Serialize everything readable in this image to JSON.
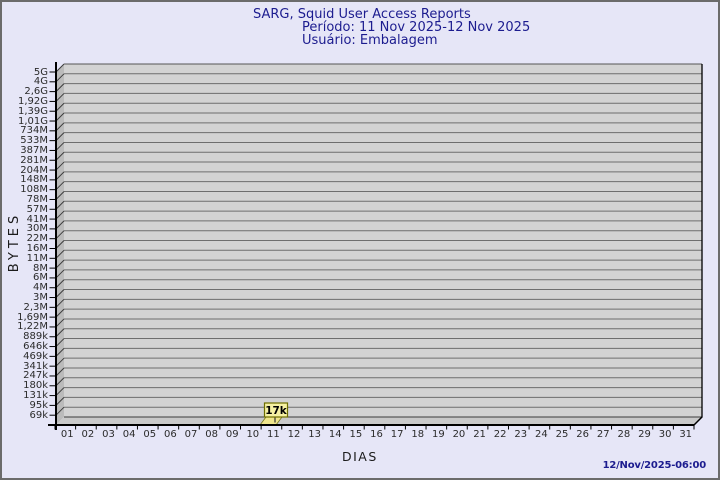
{
  "header": {
    "title": "SARG, Squid User Access Reports",
    "period": "Período: 11 Nov 2025-12 Nov 2025",
    "user": "Usuário: Embalagem"
  },
  "footer": {
    "timestamp": "12/Nov/2025-06:00"
  },
  "chart_data": {
    "type": "bar",
    "style": "3d-bars",
    "title": "SARG, Squid User Access Reports",
    "subtitle_lines": [
      "Período: 11 Nov 2025-12 Nov 2025",
      "Usuário: Embalagem"
    ],
    "xlabel": "DIAS",
    "ylabel": "BYTES",
    "y_scale": "logarithmic",
    "grid": true,
    "legend": null,
    "y_tick_labels": [
      "5G",
      "4G",
      "2,6G",
      "1,92G",
      "1,39G",
      "1,01G",
      "734M",
      "533M",
      "387M",
      "281M",
      "204M",
      "148M",
      "108M",
      "78M",
      "57M",
      "41M",
      "30M",
      "22M",
      "16M",
      "11M",
      "8M",
      "6M",
      "4M",
      "3M",
      "2,3M",
      "1,69M",
      "1,22M",
      "889k",
      "646k",
      "469k",
      "341k",
      "247k",
      "180k",
      "131k",
      "95k",
      "69k"
    ],
    "categories": [
      "01",
      "02",
      "03",
      "04",
      "05",
      "06",
      "07",
      "08",
      "09",
      "10",
      "11",
      "12",
      "13",
      "14",
      "15",
      "16",
      "17",
      "18",
      "19",
      "20",
      "21",
      "22",
      "23",
      "24",
      "25",
      "26",
      "27",
      "28",
      "29",
      "30",
      "31"
    ],
    "series": [
      {
        "name": "Embalagem",
        "unit": "bytes",
        "values": [
          0,
          0,
          0,
          0,
          0,
          0,
          0,
          0,
          0,
          0,
          17000,
          0,
          0,
          0,
          0,
          0,
          0,
          0,
          0,
          0,
          0,
          0,
          0,
          0,
          0,
          0,
          0,
          0,
          0,
          0,
          0
        ]
      }
    ],
    "annotations": [
      {
        "x": "11",
        "label": "17k",
        "value_bytes": 17000
      }
    ],
    "colors": {
      "bar": "#f0e68c",
      "bar_label_bg": "#f6f1a3",
      "bar_label_border": "#6e6e00",
      "plot_bg": "#d3d3d3",
      "gridline": "#6e6e6e",
      "wall": "#bbbbbb",
      "floor": "#c9c9c9",
      "page_bg": "#e6e6f7",
      "title_text": "#1c1c8f"
    }
  }
}
